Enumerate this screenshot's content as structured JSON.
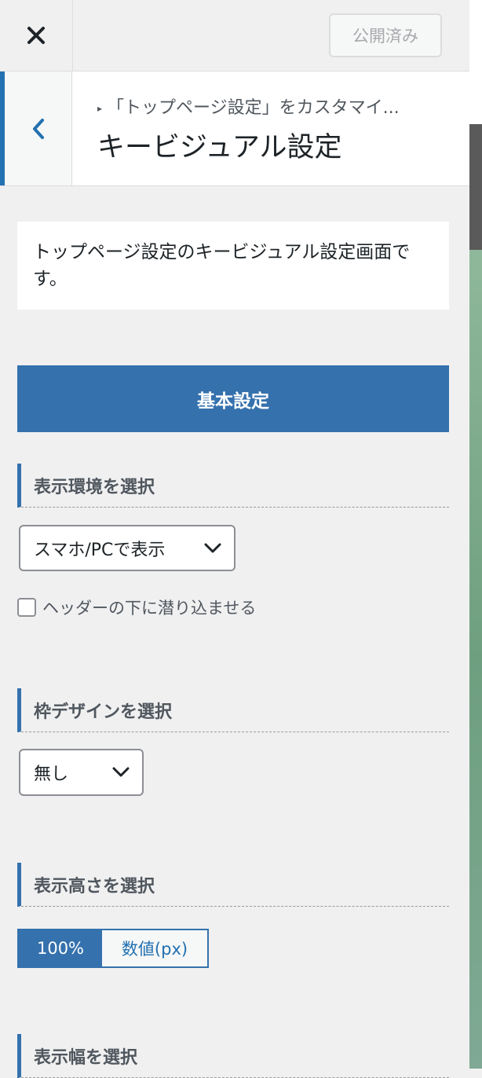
{
  "header": {
    "close_icon": "close-icon",
    "publish_label": "公開済み"
  },
  "section": {
    "breadcrumb": "「トップページ設定」をカスタマイ...",
    "title": "キービジュアル設定"
  },
  "description": "トップページ設定のキービジュアル設定画面です。",
  "basic_settings_label": "基本設定",
  "groups": {
    "display_env": {
      "title": "表示環境を選択",
      "selected": "スマホ/PCで表示",
      "checkbox_label": "ヘッダーの下に潜り込ませる",
      "checked": false
    },
    "frame_design": {
      "title": "枠デザインを選択",
      "selected": "無し"
    },
    "display_height": {
      "title": "表示高さを選択",
      "options": [
        "100%",
        "数値(px)"
      ],
      "selected": "100%"
    },
    "display_width": {
      "title": "表示幅を選択"
    }
  },
  "colors": {
    "accent": "#3571ad",
    "link": "#2271b1"
  }
}
